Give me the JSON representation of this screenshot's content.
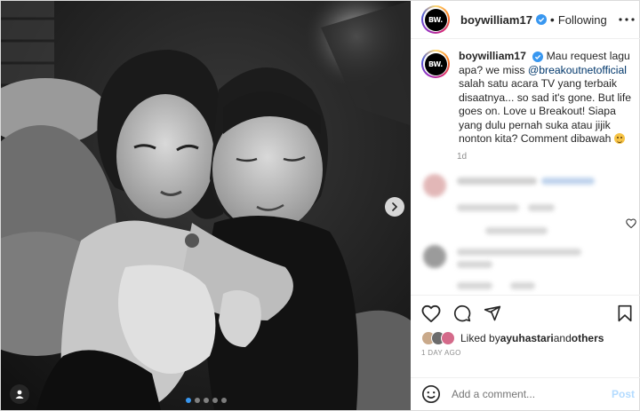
{
  "header": {
    "avatar_text": "BW.",
    "username": "boywilliam17",
    "separator": "•",
    "follow_label": "Following",
    "more_icon": "more-horizontal-icon"
  },
  "caption": {
    "avatar_text": "BW.",
    "username": "boywilliam17",
    "text_part1": "Mau request lagu apa? we miss ",
    "mention": "@breakoutnetofficial",
    "text_part2": " salah satu acara TV yang terbaik disaatnya... so sad it's gone. But life goes on. Love u Breakout! Siapa yang dulu pernah suka atau jijik nonton kita? Comment dibawah ",
    "time": "1d"
  },
  "actions": {
    "like_icon": "heart-icon",
    "comment_icon": "comment-icon",
    "share_icon": "paper-plane-icon",
    "save_icon": "bookmark-icon"
  },
  "likes": {
    "prefix": "Liked by ",
    "first_liker": "ayuhastari",
    "joiner": " and ",
    "others": "others"
  },
  "post_time": "1 DAY AGO",
  "add_comment": {
    "placeholder": "Add a comment...",
    "post_label": "Post",
    "emoji_icon": "smiley-icon"
  },
  "media": {
    "carousel_total": 5,
    "carousel_active": 1,
    "next_icon": "chevron-right-icon",
    "tag_icon": "user-tag-icon"
  },
  "colors": {
    "verified": "#3897f0",
    "mention": "#00376b",
    "muted": "#8e8e8e",
    "post_button": "#b3dbff"
  }
}
